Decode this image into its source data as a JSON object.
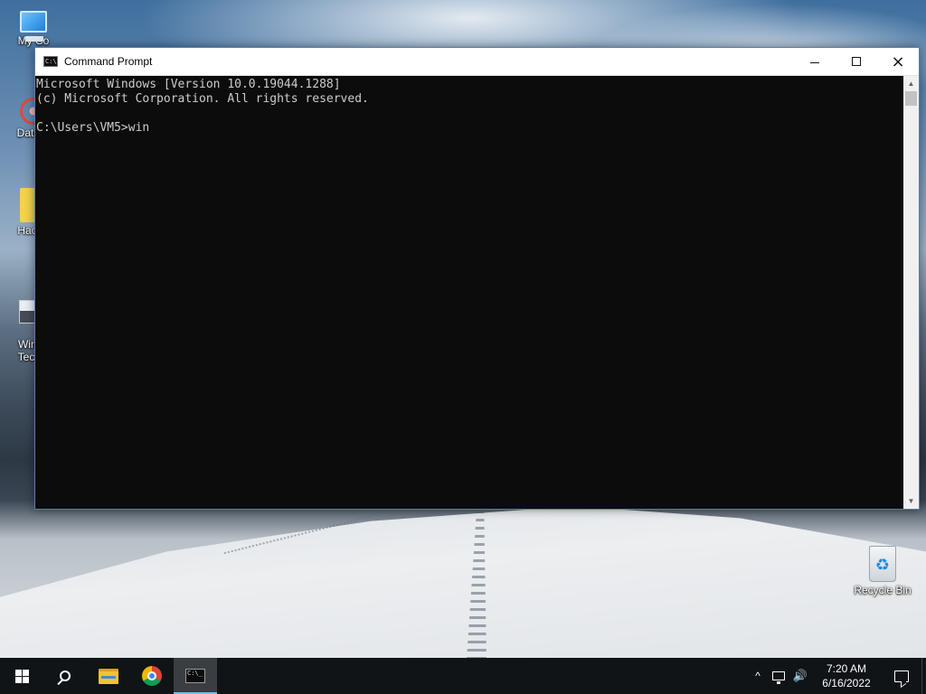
{
  "desktop": {
    "icons": [
      {
        "label": "My Co",
        "icon": "computer-icon"
      },
      {
        "label": "DataW",
        "icon": "datawrapper-icon"
      },
      {
        "label": "HackB",
        "icon": "folder-icon"
      },
      {
        "label": "Windo\nTechni",
        "icon": "document-icon"
      },
      {
        "label": "Recycle Bin",
        "icon": "recycle-bin-icon"
      }
    ]
  },
  "window": {
    "title": "Command Prompt",
    "icon": "cmd-icon",
    "controls": {
      "minimize": "minimize-icon",
      "maximize": "maximize-icon",
      "close": "×"
    },
    "console_lines": [
      "Microsoft Windows [Version 10.0.19044.1288]",
      "(c) Microsoft Corporation. All rights reserved.",
      "",
      "C:\\Users\\VM5>win"
    ],
    "scroll_up": "▲",
    "scroll_down": "▼"
  },
  "taskbar": {
    "buttons": [
      {
        "name": "start",
        "icon": "windows-start-icon"
      },
      {
        "name": "search",
        "icon": "search-icon"
      },
      {
        "name": "file-explorer",
        "icon": "folder-icon"
      },
      {
        "name": "chrome",
        "icon": "chrome-icon"
      },
      {
        "name": "command-prompt",
        "icon": "cmd-icon",
        "active": true
      }
    ],
    "tray": {
      "chevron": "^",
      "volume": "🔊",
      "time": "7:20 AM",
      "date": "6/16/2022"
    }
  },
  "colors": {
    "taskbar_bg": "#101417",
    "console_bg": "#0c0c0c",
    "console_text": "#cccccc",
    "active_indicator": "#76b9ed"
  }
}
